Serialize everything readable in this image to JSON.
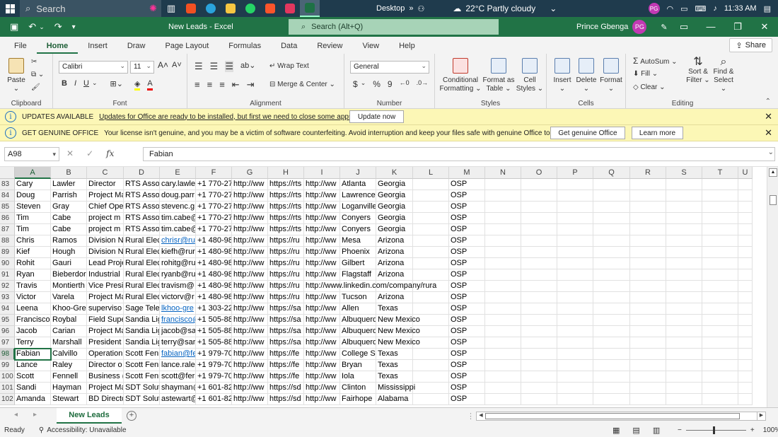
{
  "taskbar": {
    "search_placeholder": "Search",
    "desktop_label": "Desktop",
    "weather": "22°C  Partly cloudy",
    "user_initials": "PG",
    "time": "11:33 AM"
  },
  "titlebar": {
    "doc_title": "New Leads  -  Excel",
    "search_placeholder": "Search (Alt+Q)",
    "user_name": "Prince Gbenga",
    "user_initials": "PG"
  },
  "ribbon_tabs": [
    "File",
    "Home",
    "Insert",
    "Draw",
    "Page Layout",
    "Formulas",
    "Data",
    "Review",
    "View",
    "Help"
  ],
  "share_label": "Share",
  "ribbon": {
    "clipboard": {
      "label": "Clipboard",
      "paste": "Paste"
    },
    "font": {
      "label": "Font",
      "name": "Calibri",
      "size": "11",
      "bold": "B",
      "italic": "I",
      "underline": "U"
    },
    "alignment": {
      "label": "Alignment",
      "wrap": "Wrap Text",
      "merge": "Merge & Center"
    },
    "number": {
      "label": "Number",
      "format": "General",
      "currency": "$",
      "percent": "%",
      "comma": "9"
    },
    "styles": {
      "label": "Styles",
      "conditional_1": "Conditional",
      "conditional_2": "Formatting",
      "format_as_1": "Format as",
      "format_as_2": "Table",
      "cell_1": "Cell",
      "cell_2": "Styles"
    },
    "cells": {
      "label": "Cells",
      "insert": "Insert",
      "delete": "Delete",
      "format": "Format"
    },
    "editing": {
      "label": "Editing",
      "autosum": "AutoSum",
      "fill": "Fill",
      "clear": "Clear",
      "sort_1": "Sort &",
      "sort_2": "Filter",
      "find_1": "Find &",
      "find_2": "Select"
    }
  },
  "messages": [
    {
      "title": "UPDATES AVAILABLE",
      "text": "Updates for Office are ready to be installed, but first we need to close some apps.",
      "buttons": [
        "Update now"
      ]
    },
    {
      "title": "GET GENUINE OFFICE",
      "text": "Your license isn't genuine, and you may be a victim of software counterfeiting. Avoid interruption and keep your files safe with genuine Office today.",
      "buttons": [
        "Get genuine Office",
        "Learn more"
      ]
    }
  ],
  "formula_bar": {
    "name_box": "A98",
    "fx": "fx",
    "value": "Fabian"
  },
  "columns": [
    "A",
    "B",
    "C",
    "D",
    "E",
    "F",
    "G",
    "H",
    "I",
    "J",
    "K",
    "L",
    "M",
    "N",
    "O",
    "P",
    "Q",
    "R",
    "S",
    "T",
    "U"
  ],
  "rows": [
    {
      "num": "83",
      "cells": [
        "Cary",
        "Lawler",
        "Director",
        "RTS Assoc",
        "cary.lawle",
        "+1 770-27",
        "http://ww",
        "https://rts",
        "http://ww",
        "Atlanta",
        "Georgia",
        "",
        "OSP"
      ]
    },
    {
      "num": "84",
      "cells": [
        "Doug",
        "Parrish",
        "Project Ma",
        "RTS Assoc",
        "doug.parr",
        "+1 770-27",
        "http://ww",
        "https://rts",
        "http://ww",
        "Lawrencev",
        "Georgia",
        "",
        "OSP"
      ]
    },
    {
      "num": "85",
      "cells": [
        "Steven",
        "Gray",
        "Chief Ope",
        "RTS Assoc",
        "stevenc.g",
        "+1 770-27",
        "http://ww",
        "https://rts",
        "http://ww",
        "Loganville",
        "Georgia",
        "",
        "OSP"
      ]
    },
    {
      "num": "86",
      "cells": [
        "Tim",
        "Cabe",
        "project m",
        "RTS Assoc",
        "tim.cabe@",
        "+1 770-27",
        "http://ww",
        "https://rts",
        "http://ww",
        "Conyers",
        "Georgia",
        "",
        "OSP"
      ]
    },
    {
      "num": "87",
      "cells": [
        "Tim",
        "Cabe",
        "project m",
        "RTS Assoc",
        "tim.cabe@",
        "+1 770-27",
        "http://ww",
        "https://rts",
        "http://ww",
        "Conyers",
        "Georgia",
        "",
        "OSP"
      ]
    },
    {
      "num": "88",
      "cells": [
        "Chris",
        "Ramos",
        "Division N",
        "Rural Elec",
        "chrisr@ru",
        "+1 480-98",
        "http://ww",
        "https://ru",
        "http://ww",
        "Mesa",
        "Arizona",
        "",
        "OSP"
      ]
    },
    {
      "num": "89",
      "cells": [
        "Kief",
        "Hough",
        "Division N",
        "Rural Elec",
        "kiefh@rur",
        "+1 480-98",
        "http://ww",
        "https://ru",
        "http://ww",
        "Phoenix",
        "Arizona",
        "",
        "OSP"
      ]
    },
    {
      "num": "90",
      "cells": [
        "Rohit",
        "Gauri",
        "Lead Proje",
        "Rural Elec",
        "rohitg@ru",
        "+1 480-98",
        "http://ww",
        "https://ru",
        "http://ww",
        "Gilbert",
        "Arizona",
        "",
        "OSP"
      ]
    },
    {
      "num": "91",
      "cells": [
        "Ryan",
        "Bieberdor",
        "Industrial",
        "Rural Elec",
        "ryanb@ru",
        "+1 480-98",
        "http://ww",
        "https://ru",
        "http://ww",
        "Flagstaff",
        "Arizona",
        "",
        "OSP"
      ]
    },
    {
      "num": "92",
      "cells": [
        "Travis",
        "Montierth",
        "Vice Presi",
        "Rural Elec",
        "travism@",
        "+1 480-98",
        "http://ww",
        "https://ru",
        "http://www.linkedin.com/company/rura",
        "",
        "",
        "",
        "OSP"
      ]
    },
    {
      "num": "93",
      "cells": [
        "Victor",
        "Varela",
        "Project Ma",
        "Rural Elec",
        "victorv@r",
        "+1 480-98",
        "http://ww",
        "https://ru",
        "http://ww",
        "Tucson",
        "Arizona",
        "",
        "OSP"
      ]
    },
    {
      "num": "94",
      "cells": [
        "Leena",
        "Khoo-Gre",
        "superviso",
        "Sage Tele",
        "lkhoo-gre",
        "+1 303-22",
        "http://ww",
        "https://sa",
        "http://ww",
        "Allen",
        "Texas",
        "",
        "OSP"
      ]
    },
    {
      "num": "95",
      "cells": [
        "Francisco",
        "Roybal",
        "Field Supe",
        "Sandia Lig",
        "francisco@",
        "+1 505-88",
        "http://ww",
        "https://sa",
        "http://ww",
        "Albuquerq",
        "New Mexico",
        "",
        "OSP"
      ]
    },
    {
      "num": "96",
      "cells": [
        "Jacob",
        "Carian",
        "Project Ma",
        "Sandia Lig",
        "jacob@sa",
        "+1 505-88",
        "http://ww",
        "https://sa",
        "http://ww",
        "Albuquerq",
        "New Mexico",
        "",
        "OSP"
      ]
    },
    {
      "num": "97",
      "cells": [
        "Terry",
        "Marshall",
        "President",
        "Sandia Lig",
        "terry@sar",
        "+1 505-88",
        "http://ww",
        "https://sa",
        "http://ww",
        "Albuquerq",
        "New Mexico",
        "",
        "OSP"
      ]
    },
    {
      "num": "98",
      "cells": [
        "Fabian",
        "Calvillo",
        "Operation",
        "Scott Fenr",
        "fabian@fe",
        "+1 979-70",
        "http://ww",
        "https://fe",
        "http://ww",
        "College St",
        "Texas",
        "",
        "OSP"
      ]
    },
    {
      "num": "99",
      "cells": [
        "Lance",
        "Raley",
        "Director o",
        "Scott Fenr",
        "lance.rale",
        "+1 979-70",
        "http://ww",
        "https://fe",
        "http://ww",
        "Bryan",
        "Texas",
        "",
        "OSP"
      ]
    },
    {
      "num": "100",
      "cells": [
        "Scott",
        "Fennell",
        "Business (",
        "Scott Fenr",
        "scott@fer",
        "+1 979-70",
        "http://ww",
        "https://fe",
        "http://ww",
        "Iola",
        "Texas",
        "",
        "OSP"
      ]
    },
    {
      "num": "101",
      "cells": [
        "Sandi",
        "Hayman",
        "Project Ma",
        "SDT Soluti",
        "shayman@",
        "+1 601-82",
        "http://ww",
        "https://sd",
        "http://ww",
        "Clinton",
        "Mississippi",
        "",
        "OSP"
      ]
    },
    {
      "num": "102",
      "cells": [
        "Amanda",
        "Stewart",
        "BD Directo",
        "SDT Soluti",
        "astewart@",
        "+1 601-82",
        "http://ww",
        "https://sd",
        "http://ww",
        "Fairhope",
        "Alabama",
        "",
        "OSP"
      ]
    }
  ],
  "link_cells": [
    "88-4",
    "94-4",
    "95-4",
    "98-4"
  ],
  "active_cell": "98-0",
  "sheet_tab": "New Leads",
  "status": {
    "ready": "Ready",
    "accessibility": "Accessibility: Unavailable",
    "zoom": "100%"
  }
}
